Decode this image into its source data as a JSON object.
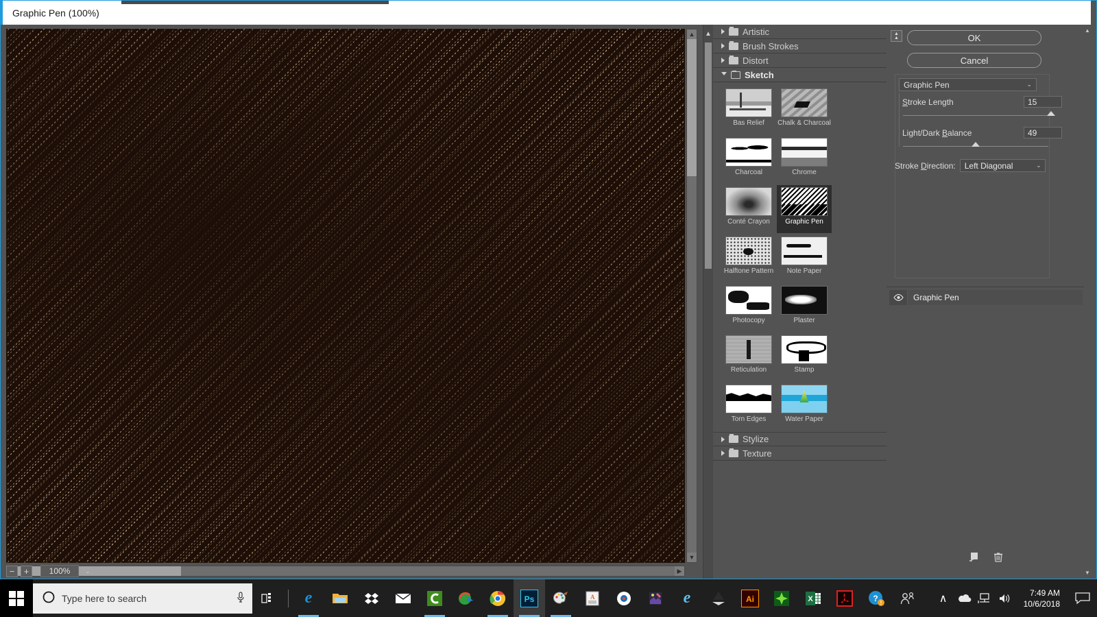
{
  "window": {
    "title": "Graphic Pen (100%)"
  },
  "preview": {
    "zoom_out_label": "−",
    "zoom_in_label": "+",
    "zoom_value": "100%",
    "caret": "⌄",
    "canvas_bg": "#1d0f07",
    "canvas_stroke": "#e8c49a"
  },
  "filter_list": {
    "categories": [
      {
        "label": "Artistic",
        "expanded": false
      },
      {
        "label": "Brush Strokes",
        "expanded": false
      },
      {
        "label": "Distort",
        "expanded": false
      },
      {
        "label": "Sketch",
        "expanded": true
      },
      {
        "label": "Stylize",
        "expanded": false
      },
      {
        "label": "Texture",
        "expanded": false
      }
    ],
    "sketch_filters": [
      {
        "label": "Bas Relief",
        "art": "ti-basrelief",
        "selected": false
      },
      {
        "label": "Chalk & Charcoal",
        "art": "ti-chalk",
        "selected": false
      },
      {
        "label": "Charcoal",
        "art": "ti-charcoal",
        "selected": false
      },
      {
        "label": "Chrome",
        "art": "ti-chrome",
        "selected": false
      },
      {
        "label": "Conté Crayon",
        "art": "ti-conte",
        "selected": false
      },
      {
        "label": "Graphic Pen",
        "art": "ti-graphicpen",
        "selected": true
      },
      {
        "label": "Halftone Pattern",
        "art": "ti-halftone",
        "selected": false
      },
      {
        "label": "Note Paper",
        "art": "ti-notepaper",
        "selected": false
      },
      {
        "label": "Photocopy",
        "art": "ti-photocopy",
        "selected": false
      },
      {
        "label": "Plaster",
        "art": "ti-plaster",
        "selected": false
      },
      {
        "label": "Reticulation",
        "art": "ti-reticulation",
        "selected": false
      },
      {
        "label": "Stamp",
        "art": "ti-stamp",
        "selected": false
      },
      {
        "label": "Torn Edges",
        "art": "ti-torn",
        "selected": false
      },
      {
        "label": "Water Paper",
        "art": "ti-waterpaper",
        "selected": false
      }
    ]
  },
  "settings": {
    "ok_label": "OK",
    "cancel_label": "Cancel",
    "filter_name": "Graphic Pen",
    "caret": "⌄",
    "params": [
      {
        "label_pre": "",
        "label_accel": "S",
        "label_post": "troke Length",
        "value": "15",
        "thumb_pct": 99
      },
      {
        "label_pre": "Light/Dark ",
        "label_accel": "B",
        "label_post": "alance",
        "value": "49",
        "thumb_pct": 47
      }
    ],
    "direction_label_pre": "Stroke ",
    "direction_label_accel": "D",
    "direction_label_post": "irection:",
    "direction_value": "Left Diagonal"
  },
  "stack": {
    "layers": [
      {
        "name": "Graphic Pen",
        "visible": true
      }
    ],
    "new_layer_icon": "new-filter-layer-icon",
    "delete_icon": "delete-filter-layer-icon"
  },
  "taskbar": {
    "search_placeholder": "Type here to search",
    "apps": [
      {
        "name": "edge",
        "glyph": "e",
        "color": "#1e90d2",
        "active": false,
        "running": true
      },
      {
        "name": "file-explorer",
        "glyph": "📁",
        "color": "#ffc24d",
        "active": false,
        "running": false
      },
      {
        "name": "dropbox",
        "glyph": "❖",
        "color": "#ffffff",
        "active": false,
        "running": false
      },
      {
        "name": "mail",
        "glyph": "✉",
        "color": "#ffffff",
        "active": false,
        "running": false
      },
      {
        "name": "camtasia",
        "glyph": "C",
        "color": "#4caf21",
        "active": false,
        "running": true
      },
      {
        "name": "internet-download-manager",
        "glyph": "◔",
        "color": "#2e9e3e",
        "active": false,
        "running": false
      },
      {
        "name": "chrome",
        "glyph": "●",
        "color": "#e8453c",
        "active": false,
        "running": true
      },
      {
        "name": "photoshop",
        "glyph": "Ps",
        "color": "#31c5f0",
        "active": true,
        "running": true
      },
      {
        "name": "paint",
        "glyph": "🎨",
        "color": "#d8d8d8",
        "active": false,
        "running": true
      },
      {
        "name": "document-viewer",
        "glyph": "A",
        "color": "#e06c2b",
        "active": false,
        "running": false
      },
      {
        "name": "media-player",
        "glyph": "◉",
        "color": "#1a6fb5",
        "active": false,
        "running": false
      },
      {
        "name": "photo-editor",
        "glyph": "✎",
        "color": "#e8c45a",
        "active": false,
        "running": false
      },
      {
        "name": "internet-explorer",
        "glyph": "e",
        "color": "#5fc0f0",
        "active": false,
        "running": false
      },
      {
        "name": "inkscape",
        "glyph": "▲",
        "color": "#3a3a3a",
        "active": false,
        "running": false
      },
      {
        "name": "illustrator",
        "glyph": "Ai",
        "color": "#ff9a00",
        "active": false,
        "running": false
      },
      {
        "name": "coreldraw",
        "glyph": "✳",
        "color": "#7ee03a",
        "active": false,
        "running": false
      },
      {
        "name": "excel",
        "glyph": "X",
        "color": "#1d6f42",
        "active": false,
        "running": false
      },
      {
        "name": "acrobat-reader",
        "glyph": "⎈",
        "color": "#e02020",
        "active": false,
        "running": false
      },
      {
        "name": "get-help",
        "glyph": "?",
        "color": "#1e90d2",
        "active": false,
        "running": false
      },
      {
        "name": "contacts",
        "glyph": "☺",
        "color": "#e0e0e0",
        "active": false,
        "running": false
      }
    ],
    "tray": {
      "show_hidden": "∧",
      "onedrive": "☁",
      "network": "🖥",
      "volume": "🔊",
      "time": "7:49 AM",
      "date": "10/6/2018",
      "action_center": "🗪"
    }
  }
}
